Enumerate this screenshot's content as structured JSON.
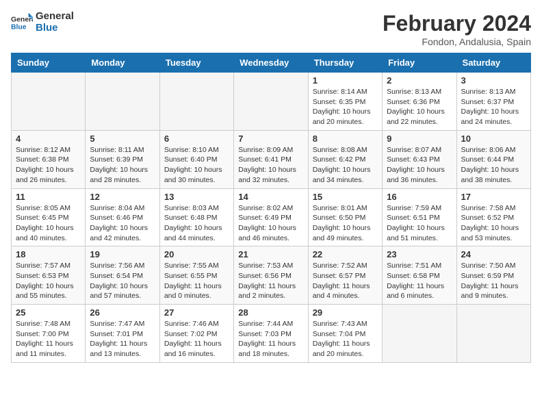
{
  "header": {
    "logo_general": "General",
    "logo_blue": "Blue",
    "title": "February 2024",
    "subtitle": "Fondon, Andalusia, Spain"
  },
  "days_of_week": [
    "Sunday",
    "Monday",
    "Tuesday",
    "Wednesday",
    "Thursday",
    "Friday",
    "Saturday"
  ],
  "weeks": [
    [
      {
        "day": "",
        "info": ""
      },
      {
        "day": "",
        "info": ""
      },
      {
        "day": "",
        "info": ""
      },
      {
        "day": "",
        "info": ""
      },
      {
        "day": "1",
        "info": "Sunrise: 8:14 AM\nSunset: 6:35 PM\nDaylight: 10 hours and 20 minutes."
      },
      {
        "day": "2",
        "info": "Sunrise: 8:13 AM\nSunset: 6:36 PM\nDaylight: 10 hours and 22 minutes."
      },
      {
        "day": "3",
        "info": "Sunrise: 8:13 AM\nSunset: 6:37 PM\nDaylight: 10 hours and 24 minutes."
      }
    ],
    [
      {
        "day": "4",
        "info": "Sunrise: 8:12 AM\nSunset: 6:38 PM\nDaylight: 10 hours and 26 minutes."
      },
      {
        "day": "5",
        "info": "Sunrise: 8:11 AM\nSunset: 6:39 PM\nDaylight: 10 hours and 28 minutes."
      },
      {
        "day": "6",
        "info": "Sunrise: 8:10 AM\nSunset: 6:40 PM\nDaylight: 10 hours and 30 minutes."
      },
      {
        "day": "7",
        "info": "Sunrise: 8:09 AM\nSunset: 6:41 PM\nDaylight: 10 hours and 32 minutes."
      },
      {
        "day": "8",
        "info": "Sunrise: 8:08 AM\nSunset: 6:42 PM\nDaylight: 10 hours and 34 minutes."
      },
      {
        "day": "9",
        "info": "Sunrise: 8:07 AM\nSunset: 6:43 PM\nDaylight: 10 hours and 36 minutes."
      },
      {
        "day": "10",
        "info": "Sunrise: 8:06 AM\nSunset: 6:44 PM\nDaylight: 10 hours and 38 minutes."
      }
    ],
    [
      {
        "day": "11",
        "info": "Sunrise: 8:05 AM\nSunset: 6:45 PM\nDaylight: 10 hours and 40 minutes."
      },
      {
        "day": "12",
        "info": "Sunrise: 8:04 AM\nSunset: 6:46 PM\nDaylight: 10 hours and 42 minutes."
      },
      {
        "day": "13",
        "info": "Sunrise: 8:03 AM\nSunset: 6:48 PM\nDaylight: 10 hours and 44 minutes."
      },
      {
        "day": "14",
        "info": "Sunrise: 8:02 AM\nSunset: 6:49 PM\nDaylight: 10 hours and 46 minutes."
      },
      {
        "day": "15",
        "info": "Sunrise: 8:01 AM\nSunset: 6:50 PM\nDaylight: 10 hours and 49 minutes."
      },
      {
        "day": "16",
        "info": "Sunrise: 7:59 AM\nSunset: 6:51 PM\nDaylight: 10 hours and 51 minutes."
      },
      {
        "day": "17",
        "info": "Sunrise: 7:58 AM\nSunset: 6:52 PM\nDaylight: 10 hours and 53 minutes."
      }
    ],
    [
      {
        "day": "18",
        "info": "Sunrise: 7:57 AM\nSunset: 6:53 PM\nDaylight: 10 hours and 55 minutes."
      },
      {
        "day": "19",
        "info": "Sunrise: 7:56 AM\nSunset: 6:54 PM\nDaylight: 10 hours and 57 minutes."
      },
      {
        "day": "20",
        "info": "Sunrise: 7:55 AM\nSunset: 6:55 PM\nDaylight: 11 hours and 0 minutes."
      },
      {
        "day": "21",
        "info": "Sunrise: 7:53 AM\nSunset: 6:56 PM\nDaylight: 11 hours and 2 minutes."
      },
      {
        "day": "22",
        "info": "Sunrise: 7:52 AM\nSunset: 6:57 PM\nDaylight: 11 hours and 4 minutes."
      },
      {
        "day": "23",
        "info": "Sunrise: 7:51 AM\nSunset: 6:58 PM\nDaylight: 11 hours and 6 minutes."
      },
      {
        "day": "24",
        "info": "Sunrise: 7:50 AM\nSunset: 6:59 PM\nDaylight: 11 hours and 9 minutes."
      }
    ],
    [
      {
        "day": "25",
        "info": "Sunrise: 7:48 AM\nSunset: 7:00 PM\nDaylight: 11 hours and 11 minutes."
      },
      {
        "day": "26",
        "info": "Sunrise: 7:47 AM\nSunset: 7:01 PM\nDaylight: 11 hours and 13 minutes."
      },
      {
        "day": "27",
        "info": "Sunrise: 7:46 AM\nSunset: 7:02 PM\nDaylight: 11 hours and 16 minutes."
      },
      {
        "day": "28",
        "info": "Sunrise: 7:44 AM\nSunset: 7:03 PM\nDaylight: 11 hours and 18 minutes."
      },
      {
        "day": "29",
        "info": "Sunrise: 7:43 AM\nSunset: 7:04 PM\nDaylight: 11 hours and 20 minutes."
      },
      {
        "day": "",
        "info": ""
      },
      {
        "day": "",
        "info": ""
      }
    ]
  ]
}
